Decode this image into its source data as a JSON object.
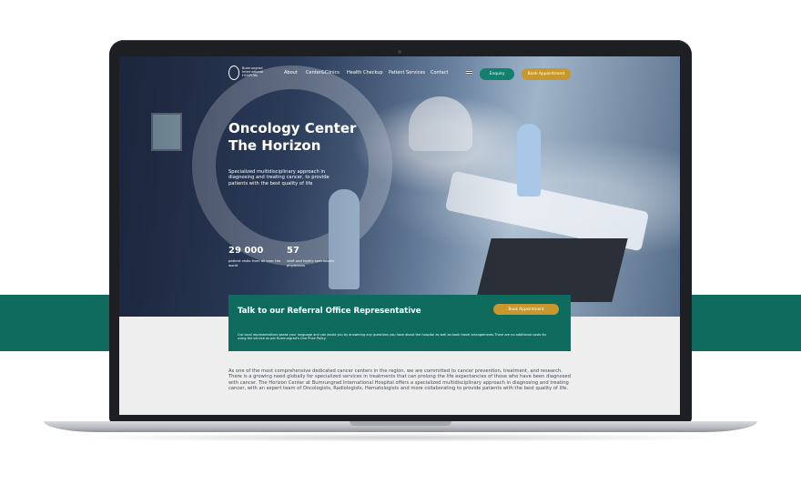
{
  "navbar": {
    "logo_text": "Bumrungrad\nInternational\nHOSPITAL",
    "links": [
      "About",
      "Center&Clinics",
      "Health Checkup",
      "Patient Services",
      "Contact"
    ],
    "language_flag_icon": "thai-flag-icon",
    "enquiry_label": "Enquiry",
    "book_label": "Book Appointment"
  },
  "hero": {
    "title_line1": "Oncology Center",
    "title_line2": "The Horizon",
    "subtitle": "Specialized multidisciplinary approach in diagnosing and treating cancer, to provide patients with the best quality of life",
    "stats": [
      {
        "value": "29 000",
        "label": "patient visits from all over the world"
      },
      {
        "value": "57",
        "label": "staff and highly specialized physicians"
      }
    ]
  },
  "referral": {
    "title": "Talk to our Referral Office Representative",
    "button_label": "Book Appointment",
    "text": "Our local representatives speak your language and can assist you by answering any questions you have about the hospital as well as book travel arrangements.There are no additional costs for using the service as per Bumrungrad's One Price Policy."
  },
  "body": {
    "text": "As one of the most comprehensive dedicated cancer centers in the region, we are committed to cancer prevention, treatment, and research. There is a growing need globally for specialized services in treatments that can prolong the life expectancies of those who have been diagnosed with cancer. The Horizon Center at Bumrungrad International Hospital offers a specialized multidisciplinary approach in diagnosing and treating cancer, with an expert team of Oncologists, Radiologists, Hematologists and more collaborating to provide patients with the best quality of life."
  },
  "colors": {
    "brand_green": "#0f6b5e",
    "enquiry_green": "#11806d",
    "gold": "#c9982c"
  }
}
